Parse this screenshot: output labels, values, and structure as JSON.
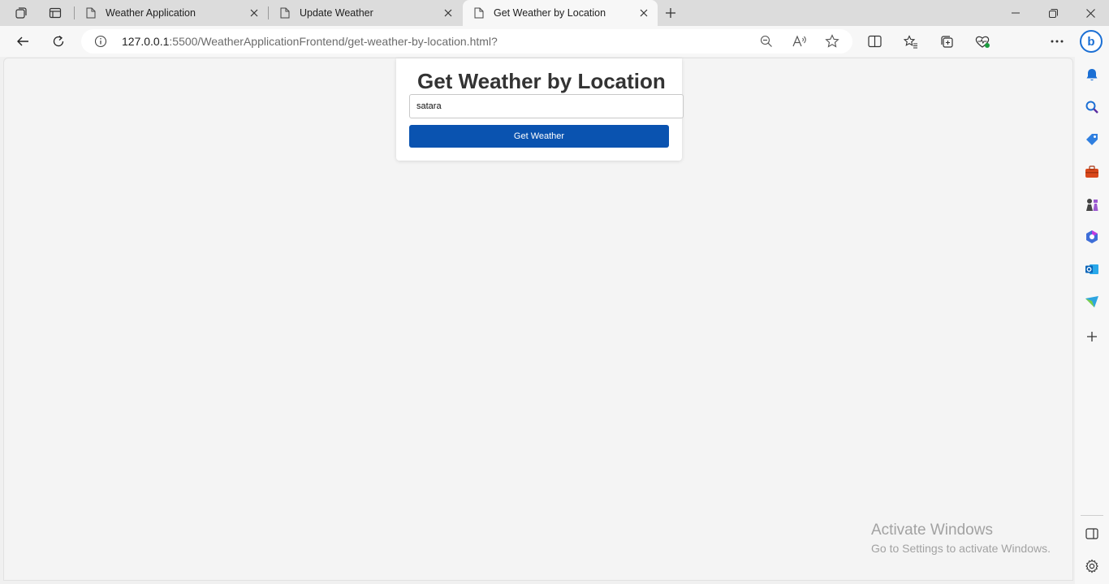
{
  "browser": {
    "tabs": [
      {
        "label": "Weather Application",
        "active": false
      },
      {
        "label": "Update Weather",
        "active": false
      },
      {
        "label": "Get Weather by Location",
        "active": true
      }
    ],
    "url_host": "127.0.0.1",
    "url_rest": ":5500/WeatherApplicationFrontend/get-weather-by-location.html?",
    "bing_letter": "b"
  },
  "page": {
    "heading": "Get Weather by Location",
    "location_value": "satara",
    "button_label": "Get Weather"
  },
  "watermark": {
    "title": "Activate Windows",
    "subtitle": "Go to Settings to activate Windows."
  },
  "icons": {
    "accent": "#0a53b0",
    "sidebar": [
      "bell-icon",
      "search-icon",
      "tag-icon",
      "toolbox-icon",
      "chess-icon",
      "office-icon",
      "outlook-icon",
      "send-icon",
      "add-icon"
    ]
  }
}
